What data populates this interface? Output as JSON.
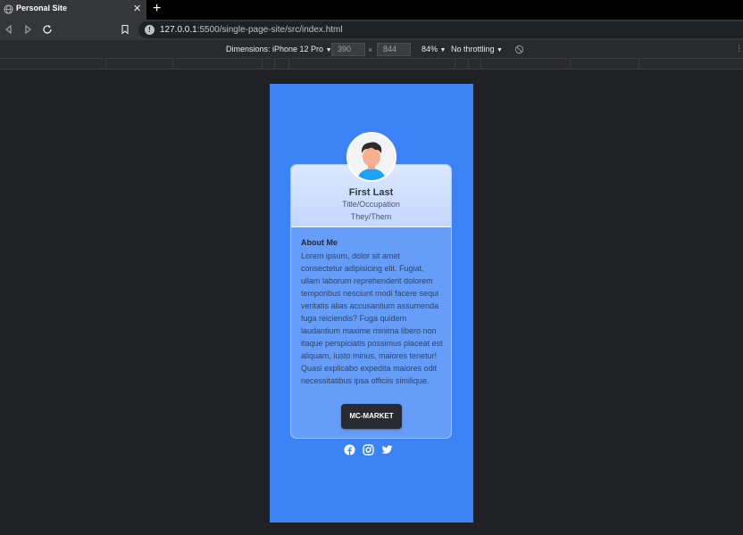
{
  "browser": {
    "tab_title": "Personal Site",
    "tab_close": "✕",
    "new_tab": "+",
    "url_host": "127.0.0.1",
    "url_path": ":5500/single-page-site/src/index.html"
  },
  "devtools": {
    "dimensions_label": "Dimensions: iPhone 12 Pro",
    "width": "390",
    "times": "×",
    "height": "844",
    "zoom": "84%",
    "throttling": "No throttling",
    "dropdown_arrow": "▼",
    "more": "⋮"
  },
  "profile": {
    "name": "First Last",
    "occupation": "Title/Occupation",
    "pronouns": "They/Them",
    "about_heading": "About Me",
    "about_text": "Lorem ipsum, dolor sit amet consectetur adipisicing elit. Fugiat, ullam laborum reprehenderit dolorem temporibus nesciunt modi facere sequi veritatis alias accusantium assumenda fuga reiciendis? Fuga quidem laudantium maxime minima libero non itaque perspiciatis possimus placeat est aliquam, iusto minus, maiores tenetur! Quasi explicabo expedita maiores odit necessitatibus ipsa officiis similique.",
    "button_label": "MC-MARKET"
  },
  "colors": {
    "page_background": "#3b82f6",
    "button_background": "#2a2b30"
  }
}
